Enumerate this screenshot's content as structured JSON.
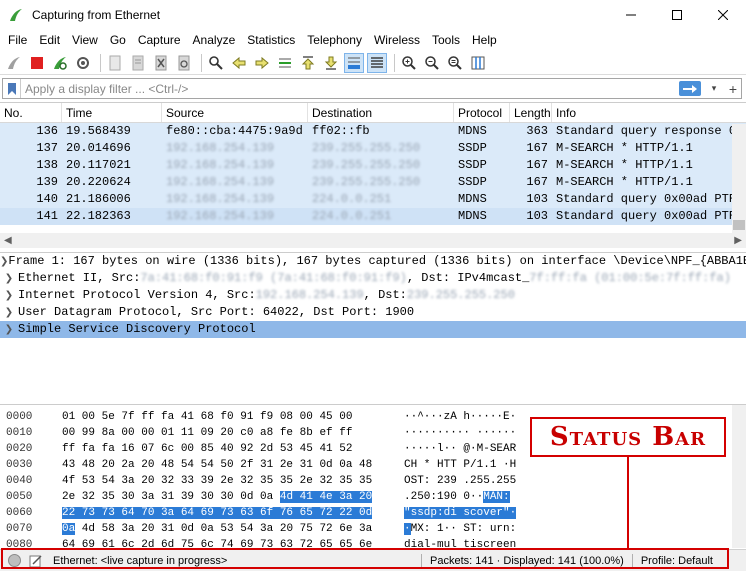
{
  "window": {
    "title": "Capturing from Ethernet"
  },
  "menu": [
    "File",
    "Edit",
    "View",
    "Go",
    "Capture",
    "Analyze",
    "Statistics",
    "Telephony",
    "Wireless",
    "Tools",
    "Help"
  ],
  "filter": {
    "placeholder": "Apply a display filter ... <Ctrl-/>"
  },
  "packet_list": {
    "columns": [
      "No.",
      "Time",
      "Source",
      "Destination",
      "Protocol",
      "Length",
      "Info"
    ],
    "rows": [
      {
        "no": "136",
        "time": "19.568439",
        "src": "fe80::cba:4475:9a9d",
        "dst": "ff02::fb",
        "proto": "MDNS",
        "len": "363",
        "info": "Standard query response 0"
      },
      {
        "no": "137",
        "time": "20.014696",
        "src": "192.168.254.139",
        "dst": "239.255.255.250",
        "proto": "SSDP",
        "len": "167",
        "info": "M-SEARCH * HTTP/1.1"
      },
      {
        "no": "138",
        "time": "20.117021",
        "src": "192.168.254.139",
        "dst": "239.255.255.250",
        "proto": "SSDP",
        "len": "167",
        "info": "M-SEARCH * HTTP/1.1"
      },
      {
        "no": "139",
        "time": "20.220624",
        "src": "192.168.254.139",
        "dst": "239.255.255.250",
        "proto": "SSDP",
        "len": "167",
        "info": "M-SEARCH * HTTP/1.1"
      },
      {
        "no": "140",
        "time": "21.186006",
        "src": "192.168.254.139",
        "dst": "224.0.0.251",
        "proto": "MDNS",
        "len": "103",
        "info": "Standard query 0x00ad PTR"
      },
      {
        "no": "141",
        "time": "22.182363",
        "src": "192.168.254.139",
        "dst": "224.0.0.251",
        "proto": "MDNS",
        "len": "103",
        "info": "Standard query 0x00ad PTR"
      }
    ]
  },
  "details": [
    {
      "text": "Frame 1: 167 bytes on wire (1336 bits), 167 bytes captured (1336 bits) on interface \\Device\\NPF_{ABBA1B"
    },
    {
      "prefix": "Ethernet II, Src: ",
      "blur1": "7a:41:68:f0:91:f9 (7a:41:68:f0:91:f9)",
      "mid": ", Dst: IPv4mcast_",
      "blur2": "7f:ff:fa (01:00:5e:7f:ff:fa)"
    },
    {
      "prefix": "Internet Protocol Version 4, Src: ",
      "blur1": "192.168.254.139",
      "mid": ", Dst: ",
      "blur2": "239.255.255.250"
    },
    {
      "text": "User Datagram Protocol, Src Port: 64022, Dst Port: 1900"
    },
    {
      "text": "Simple Service Discovery Protocol"
    }
  ],
  "bytes": [
    {
      "off": "0000",
      "hex": "01 00 5e 7f ff fa 41  68 f0 91 f9 08 00 45 00",
      "asc": "··^···zA h·····E·"
    },
    {
      "off": "0010",
      "hex": "00 99 8a 00 00 01 11  09 20 c0 a8 fe 8b ef ff",
      "asc": "·········· ······"
    },
    {
      "off": "0020",
      "hex": "ff fa fa 16 07 6c 00 85  40 92 2d 53 45 41 52",
      "asc": "·····l·· @·M-SEAR"
    },
    {
      "off": "0030",
      "hex": "43 48 20 2a 20 48 54 54  50 2f 31 2e 31 0d 0a 48",
      "asc": "CH * HTT P/1.1 ·H"
    },
    {
      "off": "0040",
      "hex": "4f 53 54 3a 20 32 33 39  2e 32 35 35 2e 32 35 35",
      "asc": "OST: 239 .255.255"
    },
    {
      "off": "0050",
      "hex_plain": "2e 32 35 30 3a 31 39 30  30 0d 0a ",
      "hex_hl": "4d 41 4e 3a 20",
      "asc_plain": ".250:190 0··",
      "asc_hl": "MAN:"
    },
    {
      "off": "0060",
      "hex_hl": "22 73 73 64 70 3a 64 69  73 63 6f 76 65 72 22 0d",
      "asc_hl": "\"ssdp:di scover\"·"
    },
    {
      "off": "0070",
      "hex_hl": "0a",
      "hex_plain": " 4d 58 3a 20 31 0d 0a  53 54 3a 20 75 72 6e 3a",
      "asc_hl": "·",
      "asc_plain": "MX: 1·· ST: urn:"
    },
    {
      "off": "0080",
      "hex": "64 69 61 6c 2d 6d 75 6c  74 69 73 63 72 65 65 6e",
      "asc": "dial-mul tiscreen"
    }
  ],
  "callout": {
    "label": "Status Bar"
  },
  "statusbar": {
    "interface": "Ethernet: <live capture in progress>",
    "packets": "Packets: 141 · Displayed: 141 (100.0%)",
    "profile": "Profile: Default"
  },
  "colors": {
    "accent": "#d40000",
    "row_bg": "#dbeaf9",
    "selected_detail": "#8fb8e8",
    "hex_highlight": "#2b7bd6"
  }
}
